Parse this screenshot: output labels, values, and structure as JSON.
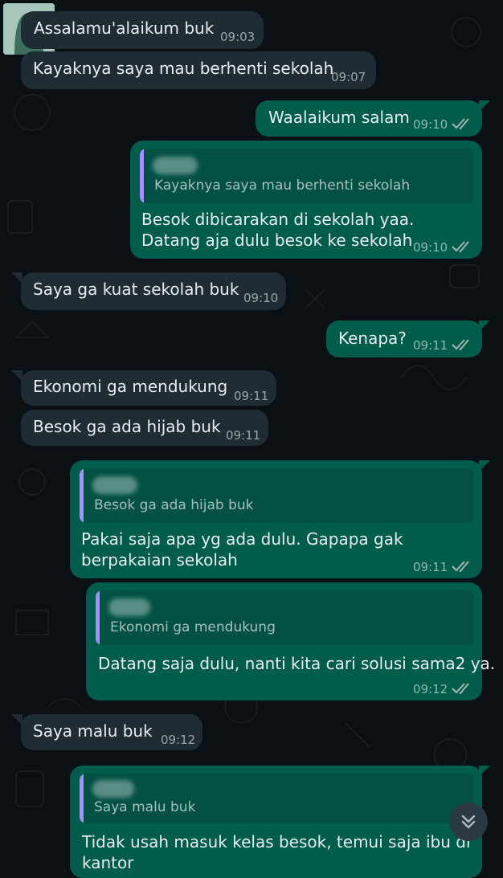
{
  "messages": [
    {
      "direction": "in",
      "text": "Assalamu'alaikum buk",
      "time": "09:03"
    },
    {
      "direction": "in",
      "text": "Kayaknya saya mau berhenti sekolah",
      "time": "09:07"
    },
    {
      "direction": "out",
      "text": "Waalaikum salam",
      "time": "09:10",
      "status": "read"
    },
    {
      "direction": "out",
      "quote": "Kayaknya saya mau berhenti sekolah",
      "lines": [
        "Besok dibicarakan di sekolah yaa.",
        "Datang aja dulu besok ke sekolah"
      ],
      "time": "09:10",
      "status": "read"
    },
    {
      "direction": "in",
      "text": "Saya ga kuat sekolah buk",
      "time": "09:10"
    },
    {
      "direction": "out",
      "text": "Kenapa?",
      "time": "09:11",
      "status": "read"
    },
    {
      "direction": "in",
      "text": "Ekonomi ga mendukung",
      "time": "09:11"
    },
    {
      "direction": "in",
      "text": "Besok ga ada hijab buk",
      "time": "09:11"
    },
    {
      "direction": "out",
      "quote": "Besok ga ada hijab buk",
      "lines": [
        "Pakai saja apa yg ada dulu. Gapapa gak",
        "berpakaian sekolah"
      ],
      "time": "09:11",
      "status": "read"
    },
    {
      "direction": "out",
      "quote": "Ekonomi ga mendukung",
      "lines": [
        "Datang saja dulu, nanti kita cari solusi sama2 ya."
      ],
      "time": "09:12",
      "status": "read"
    },
    {
      "direction": "in",
      "text": "Saya malu buk",
      "time": "09:12"
    },
    {
      "direction": "out",
      "quote": "Saya malu buk",
      "lines": [
        "Tidak usah masuk kelas besok, temui saja ibu di",
        "kantor"
      ]
    }
  ],
  "colors": {
    "incoming": "#202c33",
    "outgoing": "#005c4b",
    "read_ticks": "#a3b5ad",
    "quote_bar": "#a68eff"
  },
  "icons": {
    "scroll_down": "double-chevron-down-icon",
    "read_status": "double-check-icon"
  }
}
